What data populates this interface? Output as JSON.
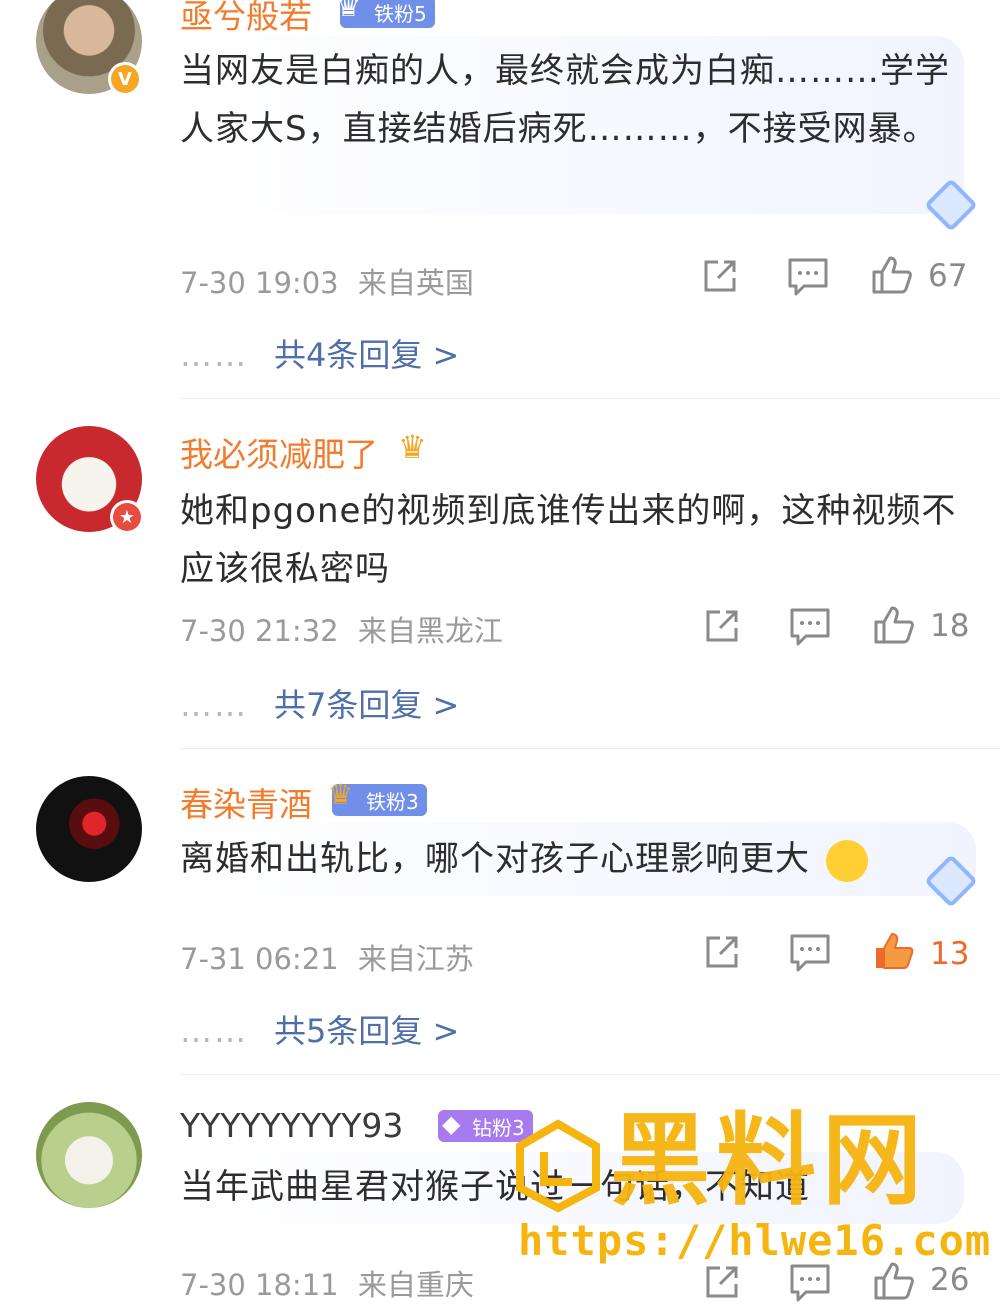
{
  "comments": [
    {
      "username": "亟兮般若",
      "fan_badge": "铁粉5",
      "text": "当网友是白痴的人，最终就会成为白痴………学学人家大S，直接结婚后病死………，不接受网暴。",
      "time": "7-30 19:03",
      "location": "来自英国",
      "likes": "67",
      "replies": "共4条回复 >"
    },
    {
      "username": "我必须减肥了",
      "text": "她和pgone的视频到底谁传出来的啊，这种视频不应该很私密吗",
      "time": "7-30 21:32",
      "location": "来自黑龙江",
      "likes": "18",
      "replies": "共7条回复 >"
    },
    {
      "username": "春染青酒",
      "fan_badge": "铁粉3",
      "text": "离婚和出轨比，哪个对孩子心理影响更大",
      "time": "7-31 06:21",
      "location": "来自江苏",
      "likes": "13",
      "liked": true,
      "replies": "共5条回复 >"
    },
    {
      "username": "YYYYYYYYY93",
      "fan_badge": "钻粉3",
      "text": "当年武曲星君对猴子说过一句话，不知道",
      "time": "7-30 18:11",
      "location": "来自重庆",
      "likes": "26"
    }
  ],
  "reply_dots": "……",
  "watermark": {
    "title": "黑料网",
    "url": "https://hlwe16.com"
  },
  "colors": {
    "username": "#f27b2c",
    "reply_link": "#4f6fa8",
    "meta": "#9a9a9a",
    "iron_fan": "#6f8fe8",
    "diamond_fan": "#a77af0",
    "liked": "#ef6a2a",
    "watermark": "#f6b40f"
  },
  "icons": [
    "share-icon",
    "comment-icon",
    "like-icon",
    "verified-icon",
    "crown-icon",
    "diamond-icon",
    "emoji-icon"
  ]
}
